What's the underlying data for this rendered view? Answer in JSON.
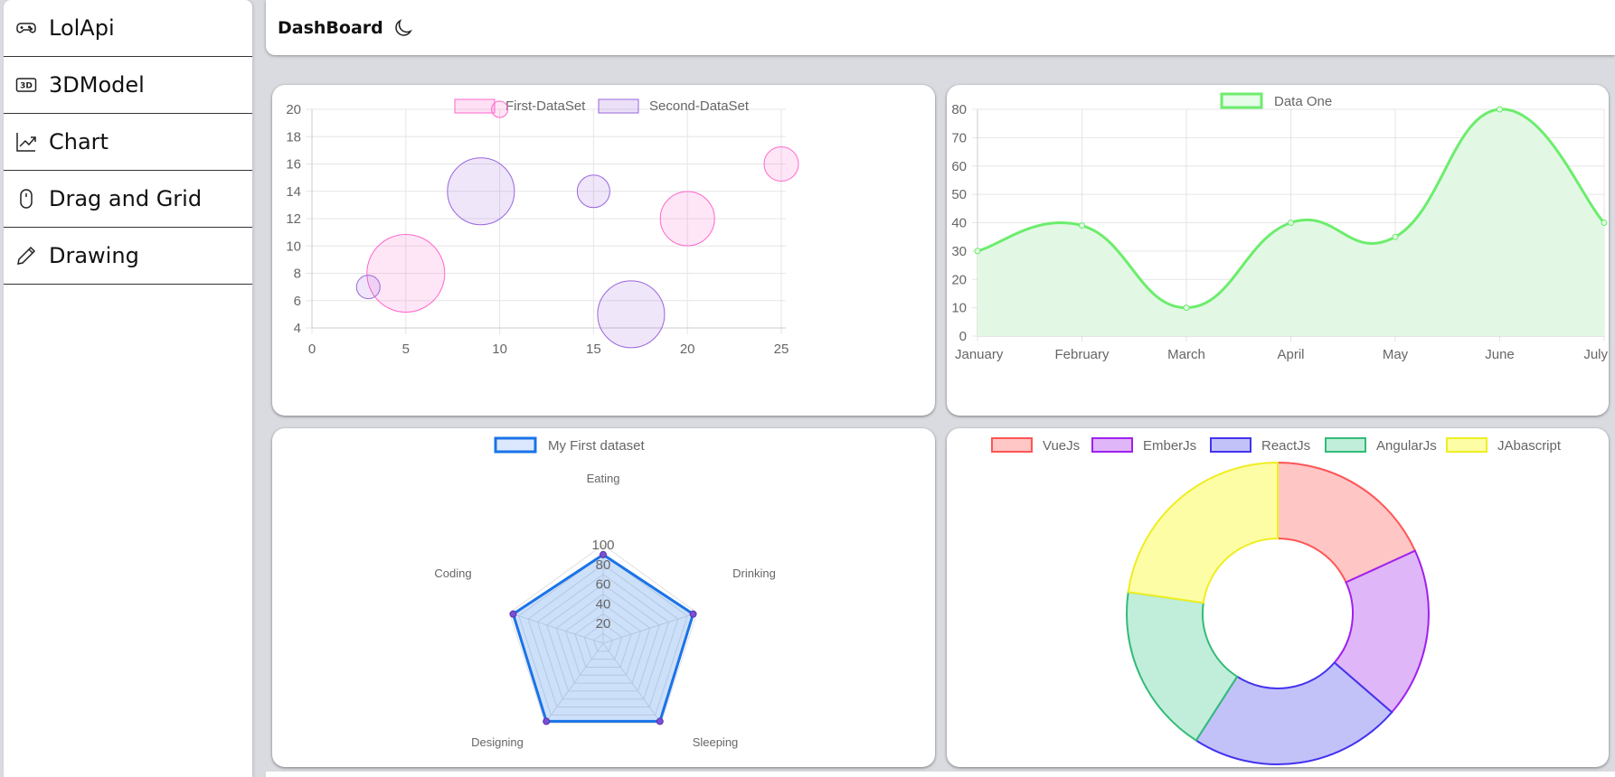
{
  "sidebar": {
    "items": [
      {
        "label": "LolApi",
        "icon": "gamepad-icon"
      },
      {
        "label": "3DModel",
        "icon": "3d-icon",
        "icon_text": "3D"
      },
      {
        "label": "Chart",
        "icon": "chart-line-icon"
      },
      {
        "label": "Drag and Grid",
        "icon": "mouse-icon"
      },
      {
        "label": "Drawing",
        "icon": "pencil-icon"
      }
    ]
  },
  "header": {
    "title": "DashBoard",
    "theme_icon": "moon-icon"
  },
  "chart_data": [
    {
      "type": "bubble",
      "xlim": [
        0,
        25
      ],
      "ylim": [
        4,
        20
      ],
      "x_ticks": [
        "0",
        "5",
        "10",
        "15",
        "20",
        "25"
      ],
      "y_ticks": [
        "4",
        "6",
        "8",
        "10",
        "12",
        "14",
        "16",
        "18",
        "20"
      ],
      "series": [
        {
          "name": "First-DataSet",
          "color": "#ff66cc",
          "points": [
            {
              "x": 5,
              "y": 8,
              "r": 43
            },
            {
              "x": 10,
              "y": 20,
              "r": 9
            },
            {
              "x": 20,
              "y": 12,
              "r": 30
            },
            {
              "x": 25,
              "y": 16,
              "r": 19
            }
          ]
        },
        {
          "name": "Second-DataSet",
          "color": "#9966dd",
          "points": [
            {
              "x": 3,
              "y": 7,
              "r": 13
            },
            {
              "x": 9,
              "y": 14,
              "r": 37
            },
            {
              "x": 15,
              "y": 14,
              "r": 18
            },
            {
              "x": 17,
              "y": 5,
              "r": 37
            }
          ]
        }
      ],
      "grid": true,
      "legend": "top"
    },
    {
      "type": "area",
      "categories": [
        "January",
        "February",
        "March",
        "April",
        "May",
        "June",
        "July"
      ],
      "ylim": [
        0,
        80
      ],
      "y_ticks": [
        "0",
        "10",
        "20",
        "30",
        "40",
        "50",
        "60",
        "70",
        "80"
      ],
      "series": [
        {
          "name": "Data One",
          "color": "#6ced6c",
          "values": [
            30,
            39,
            10,
            40,
            35,
            80,
            40
          ]
        }
      ],
      "grid": true,
      "legend": "top"
    },
    {
      "type": "radar",
      "labels": [
        "Eating",
        "Drinking",
        "Sleeping",
        "Designing",
        "Coding"
      ],
      "r_ticks": [
        "20",
        "40",
        "60",
        "80",
        "100"
      ],
      "rlim": [
        0,
        100
      ],
      "series": [
        {
          "name": "My First dataset",
          "color": "#1a73e8",
          "values": [
            90,
            96,
            98,
            98,
            96
          ]
        }
      ],
      "legend": "top"
    },
    {
      "type": "doughnut",
      "labels": [
        "VueJs",
        "EmberJs",
        "ReactJs",
        "AngularJs",
        "JAbascript"
      ],
      "values": [
        20,
        20,
        25,
        20,
        25
      ],
      "colors": [
        "#ff5555",
        "#a020f0",
        "#4433ee",
        "#33bb77",
        "#eeee22"
      ],
      "fills": [
        "#ffc6c6",
        "#dfb6f7",
        "#c2c2f9",
        "#c0eedb",
        "#fdfda6"
      ],
      "legend": "top"
    }
  ]
}
